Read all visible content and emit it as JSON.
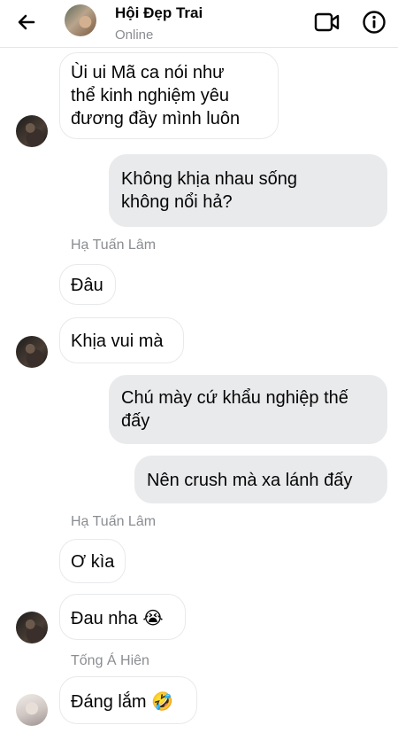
{
  "header": {
    "title": "Hội Đẹp Trai",
    "status": "Online"
  },
  "messages": [
    {
      "from": "other",
      "lines": [
        "Ùi ui Mã ca nói như",
        "thể kinh nghiệm yêu",
        "đương đầy mình luôn"
      ]
    },
    {
      "from": "me",
      "lines": [
        "Không khịa nhau sống",
        "không nổi hả?"
      ]
    },
    {
      "sender_label": "Hạ Tuấn Lâm"
    },
    {
      "from": "other",
      "lines": [
        "Đâu"
      ]
    },
    {
      "from": "other",
      "lines": [
        "Khịa vui mà"
      ]
    },
    {
      "from": "me",
      "lines": [
        "Chú mày cứ khẩu nghiệp thế",
        "đấy"
      ]
    },
    {
      "from": "me",
      "lines": [
        "Nên crush mà xa lánh đấy"
      ]
    },
    {
      "sender_label": "Hạ Tuấn Lâm"
    },
    {
      "from": "other",
      "lines": [
        "Ơ kìa"
      ]
    },
    {
      "from": "other",
      "text": "Đau nha",
      "emoji": "😭"
    },
    {
      "sender_label": "Tống Á Hiên"
    },
    {
      "from": "other",
      "text": "Đáng lắm",
      "emoji": "🤣"
    }
  ],
  "icons": {
    "back": "arrow-left-icon",
    "video": "video-camera-icon",
    "info": "info-circle-icon"
  },
  "colors": {
    "incoming_bubble": "#ffffff",
    "outgoing_bubble": "#e9eaec",
    "secondary_text": "#8a8d91"
  }
}
